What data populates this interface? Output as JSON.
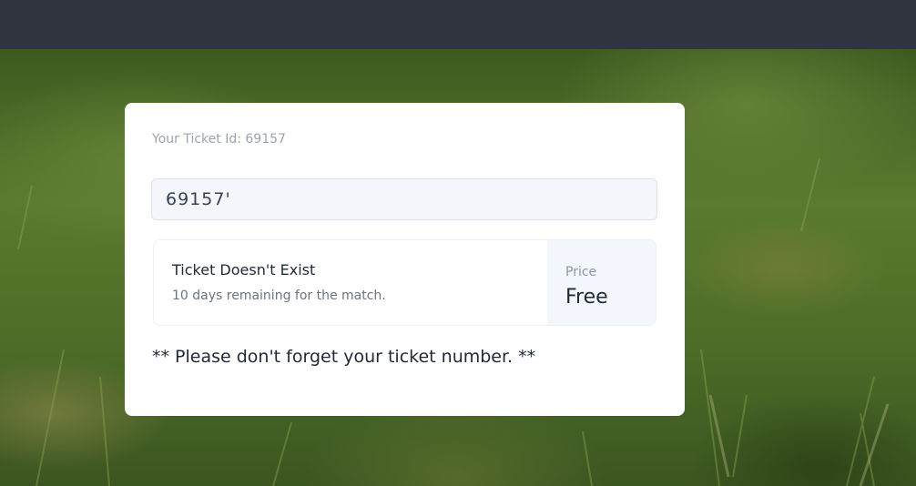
{
  "ticket": {
    "id_label": "Your Ticket Id: 69157",
    "input_value": "69157'"
  },
  "result": {
    "title": "Ticket Doesn't Exist",
    "subtitle": "10 days remaining for the match."
  },
  "price": {
    "label": "Price",
    "value": "Free"
  },
  "note": "** Please don't forget your ticket number. **",
  "colors": {
    "topbar": "#31353f",
    "card": "#ffffff",
    "input_bg": "#f5f6fb",
    "price_bg": "#f3f6fc"
  }
}
